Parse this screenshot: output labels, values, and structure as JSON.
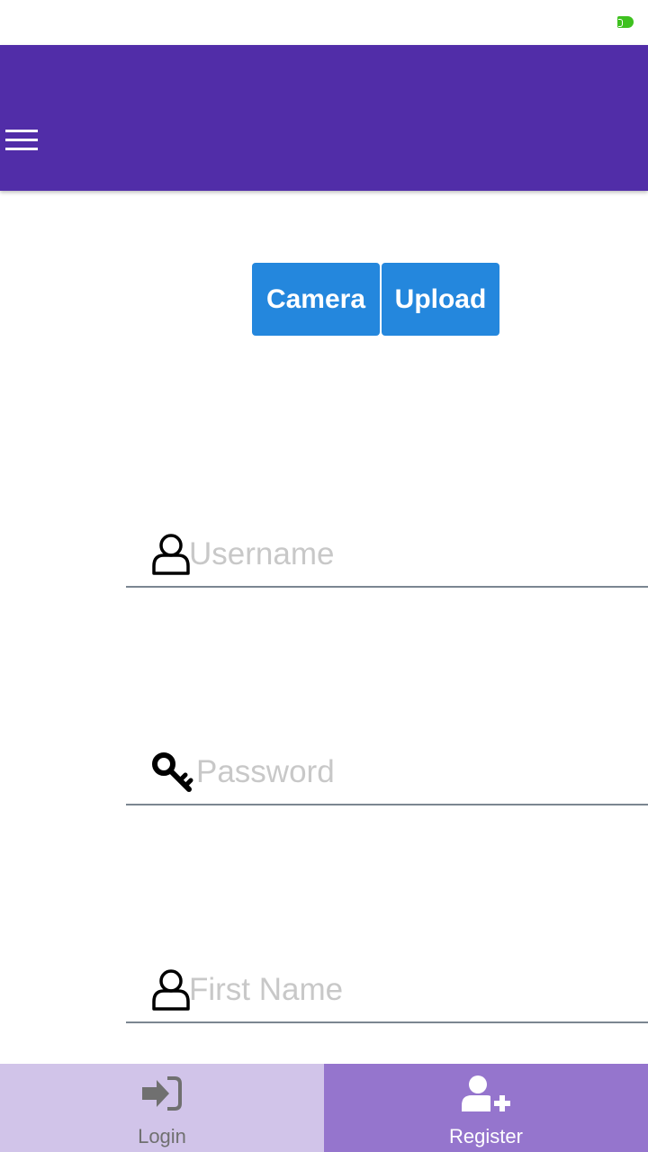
{
  "status_bar": {
    "battery_icon": "battery-icon",
    "battery_color": "#3ec11f"
  },
  "app_bar": {
    "color": "#512da8",
    "menu_icon": "hamburger-menu-icon"
  },
  "photo_buttons": {
    "camera_label": "Camera",
    "upload_label": "Upload",
    "color": "#2487dd"
  },
  "form": {
    "username": {
      "placeholder": "Username",
      "value": "",
      "icon": "user-icon"
    },
    "password": {
      "placeholder": "Password",
      "value": "",
      "icon": "key-icon"
    },
    "first_name": {
      "placeholder": "First Name",
      "value": "",
      "icon": "user-icon"
    }
  },
  "bottom_nav": {
    "tabs": [
      {
        "label": "Login",
        "icon": "sign-in-icon",
        "active": false
      },
      {
        "label": "Register",
        "icon": "add-user-icon",
        "active": true
      }
    ],
    "inactive_color": "#d1c4e9",
    "active_color": "#9575cd"
  }
}
